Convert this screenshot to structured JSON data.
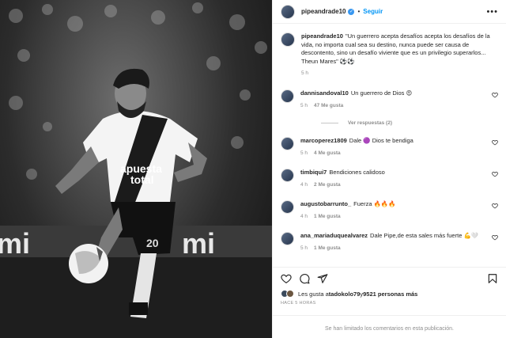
{
  "post": {
    "username": "pipeandrade10",
    "follow_label": "Seguir",
    "separator": "•",
    "more": "•••"
  },
  "caption": {
    "username": "pipeandrade10",
    "text": "\"Un guerrero acepta desafíos acepta los desafíos de la vida, no importa cual sea su destino, nunca puede ser causa de descontento, sino un desafío viviente que es un privilegio superarlos... Theun Mares\" ⚽⚽",
    "time": "5 h"
  },
  "comments": [
    {
      "username": "dannisandoval10",
      "text": "Un guerrero de Dios 😍",
      "time": "5 h",
      "likes": "47 Me gusta",
      "reply": "Responder"
    },
    {
      "username": "marcoperez1809",
      "text": "Dale 🟣 Dios te bendiga",
      "time": "5 h",
      "likes": "4 Me gusta",
      "reply": "Responder"
    },
    {
      "username": "timbiqui7",
      "text": "Bendiciones calidoso",
      "time": "4 h",
      "likes": "2 Me gusta",
      "reply": "Responder"
    },
    {
      "username": "augustobarrunto_",
      "text": "Fuerza 🔥🔥🔥",
      "time": "4 h",
      "likes": "1 Me gusta",
      "reply": "Responder"
    },
    {
      "username": "ana_mariaduquealvarez",
      "text": "Dale Pipe,de esta sales más fuerte 💪🤍",
      "time": "5 h",
      "likes": "1 Me gusta",
      "reply": "Responder"
    }
  ],
  "view_replies": "Ver respuestas (2)",
  "likes_summary": {
    "prefix": "Les gusta a ",
    "user": "tadokolo79",
    "middle": " y ",
    "count": "9521 personas más"
  },
  "time_ago": "HACE 5 HORAS",
  "comments_limited": "Se han limitado los comentarios en esta publicación."
}
